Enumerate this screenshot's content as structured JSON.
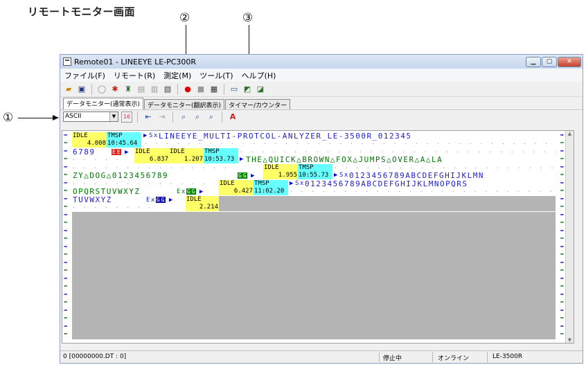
{
  "caption": "リモートモニター画面",
  "callouts": [
    "①",
    "②",
    "③"
  ],
  "window": {
    "title": "Remote01 - LINEEYE LE-PC300R"
  },
  "menu": [
    "ファイル(F)",
    "リモート(R)",
    "測定(M)",
    "ツール(T)",
    "ヘルプ(H)"
  ],
  "tabs": [
    "データモニター(通常表示)",
    "データモニター(翻訳表示)",
    "タイマー/カウンター"
  ],
  "code_select": "ASCII",
  "icons": [
    "open-icon",
    "save-icon",
    "connect-icon",
    "disconnect-icon",
    "remote-icon",
    "copy-icon",
    "paste-icon",
    "window-icon",
    "record-icon",
    "stop-icon",
    "print-icon",
    "monitor-icon",
    "settings-icon",
    "settings2-icon",
    "find-icon",
    "find-next-icon",
    "find-prev-icon",
    "font-icon"
  ],
  "monitor": {
    "line1": {
      "idle": "IDLE",
      "tmsp": "TMSP",
      "val": "4.008",
      "time": "10:45.64",
      "data": "LINEEYE_MULTI-PROTCOL-ANLYZER_LE-3500R_012345"
    },
    "line2": {
      "data_head": "6789",
      "idle1": "IDLE",
      "idle2": "IDLE",
      "tmsp": "TMSP",
      "v1": "6.837",
      "v2": "1.207",
      "time": "10:53.73",
      "data": "THE△QUICK△BROWN△FOX△JUMPS△OVER△A△LA"
    },
    "line3": {
      "idle": "IDLE",
      "tmsp": "TMSP",
      "data_head": "ZY△DOG△0123456789",
      "v": "1.955",
      "time": "10:55.73",
      "data": "0123456789ABCDEFGHIJKLMN"
    },
    "line4": {
      "idle": "IDLE",
      "tmsp": "TMSP",
      "data_head": "OPQRSTUVWXYZ",
      "v": "6.427",
      "time": "11:02.20",
      "data": "0123456789ABCDEFGHIJKLMNOPQRS"
    },
    "line5": {
      "idle": "IDLE",
      "data_head": "TUVWXYZ",
      "v": "2.214"
    }
  },
  "status": {
    "file": "0 [00000000.DT : 0]",
    "state": "停止中",
    "online": "オンライン",
    "model": "LE-3500R"
  }
}
